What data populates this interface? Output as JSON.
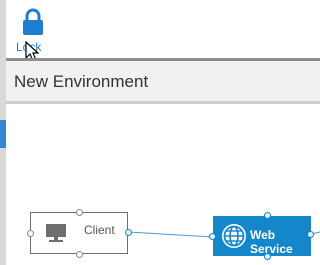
{
  "toolbar": {
    "lock": {
      "label": "Lock",
      "icon": "lock-icon"
    }
  },
  "header": {
    "title": "New Environment"
  },
  "diagram": {
    "nodes": [
      {
        "label": "Client",
        "icon": "desktop-icon"
      },
      {
        "label": "Web Service",
        "icon": "globe-icon"
      }
    ]
  },
  "colors": {
    "accent": "#1387c9",
    "link": "#1e7fd0",
    "header_bg": "#f1f1f1"
  }
}
